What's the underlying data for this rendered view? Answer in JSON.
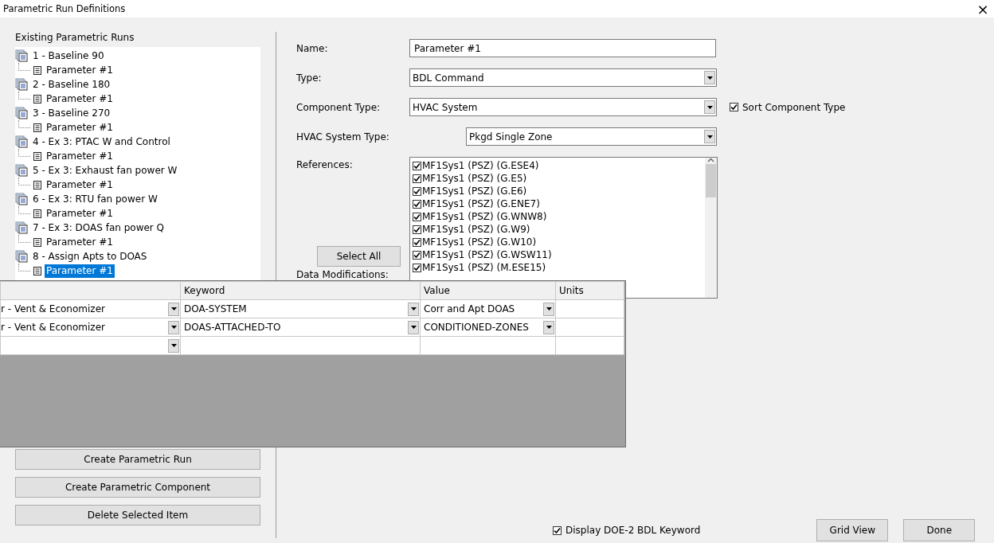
{
  "window": {
    "title": "Parametric Run Definitions",
    "close": "×"
  },
  "runs": {
    "heading": "Existing Parametric Runs",
    "items": [
      {
        "label": "1 - Baseline 90",
        "selected": false,
        "children": [
          {
            "label": "Parameter #1",
            "selected": false
          }
        ]
      },
      {
        "label": "2 - Baseline 180",
        "selected": false,
        "children": [
          {
            "label": "Parameter #1",
            "selected": false
          }
        ]
      },
      {
        "label": "3 - Baseline 270",
        "selected": false,
        "children": [
          {
            "label": "Parameter #1",
            "selected": false
          }
        ]
      },
      {
        "label": "4 - Ex 3: PTAC W and Control",
        "selected": false,
        "children": [
          {
            "label": "Parameter #1",
            "selected": false
          }
        ]
      },
      {
        "label": "5 - Ex 3: Exhaust fan power W",
        "selected": false,
        "children": [
          {
            "label": "Parameter #1",
            "selected": false
          }
        ]
      },
      {
        "label": "6 - Ex 3: RTU fan power W",
        "selected": false,
        "children": [
          {
            "label": "Parameter #1",
            "selected": false
          }
        ]
      },
      {
        "label": "7 - Ex 3: DOAS fan power Q",
        "selected": false,
        "children": [
          {
            "label": "Parameter #1",
            "selected": false
          }
        ]
      },
      {
        "label": "8 - Assign Apts to DOAS",
        "selected": false,
        "children": [
          {
            "label": "Parameter #1",
            "selected": true
          }
        ]
      }
    ]
  },
  "left_buttons": [
    "Create Parametric Run",
    "Create Parametric Component",
    "Delete Selected Item"
  ],
  "form": {
    "name": {
      "label": "Name:",
      "value": "Parameter #1"
    },
    "type": {
      "label": "Type:",
      "value": "BDL Command"
    },
    "component_type": {
      "label": "Component Type:",
      "value": "HVAC System"
    },
    "sort_component_type": {
      "label": "Sort Component Type",
      "checked": true
    },
    "hvac_system_type": {
      "label": "HVAC System Type:",
      "value": "Pkgd Single Zone"
    },
    "references": {
      "label": "References:",
      "items": [
        {
          "label": "MF1Sys1 (PSZ) (G.ESE4)",
          "checked": true
        },
        {
          "label": "MF1Sys1 (PSZ) (G.E5)",
          "checked": true
        },
        {
          "label": "MF1Sys1 (PSZ) (G.E6)",
          "checked": true
        },
        {
          "label": "MF1Sys1 (PSZ) (G.ENE7)",
          "checked": true
        },
        {
          "label": "MF1Sys1 (PSZ) (G.WNW8)",
          "checked": true
        },
        {
          "label": "MF1Sys1 (PSZ) (G.W9)",
          "checked": true
        },
        {
          "label": "MF1Sys1 (PSZ) (G.W10)",
          "checked": true
        },
        {
          "label": "MF1Sys1 (PSZ) (G.WSW11)",
          "checked": true
        },
        {
          "label": "MF1Sys1 (PSZ) (M.ESE15)",
          "checked": true
        }
      ]
    },
    "select_all": "Select All",
    "data_modifications": "Data Modifications:"
  },
  "grid": {
    "columns": [
      "Keyword",
      "Value",
      "Units"
    ],
    "rows": [
      {
        "column_1": "r - Vent & Economizer",
        "keyword": "DOA-SYSTEM",
        "value": "Corr and Apt DOAS"
      },
      {
        "column_1": "r - Vent & Economizer",
        "keyword": "DOAS-ATTACHED-TO",
        "value": "CONDITIONED-ZONES"
      }
    ]
  },
  "display_keyword": {
    "label": "Display DOE-2 BDL Keyword",
    "checked": true
  },
  "buttons": [
    "Grid View",
    "Done"
  ]
}
